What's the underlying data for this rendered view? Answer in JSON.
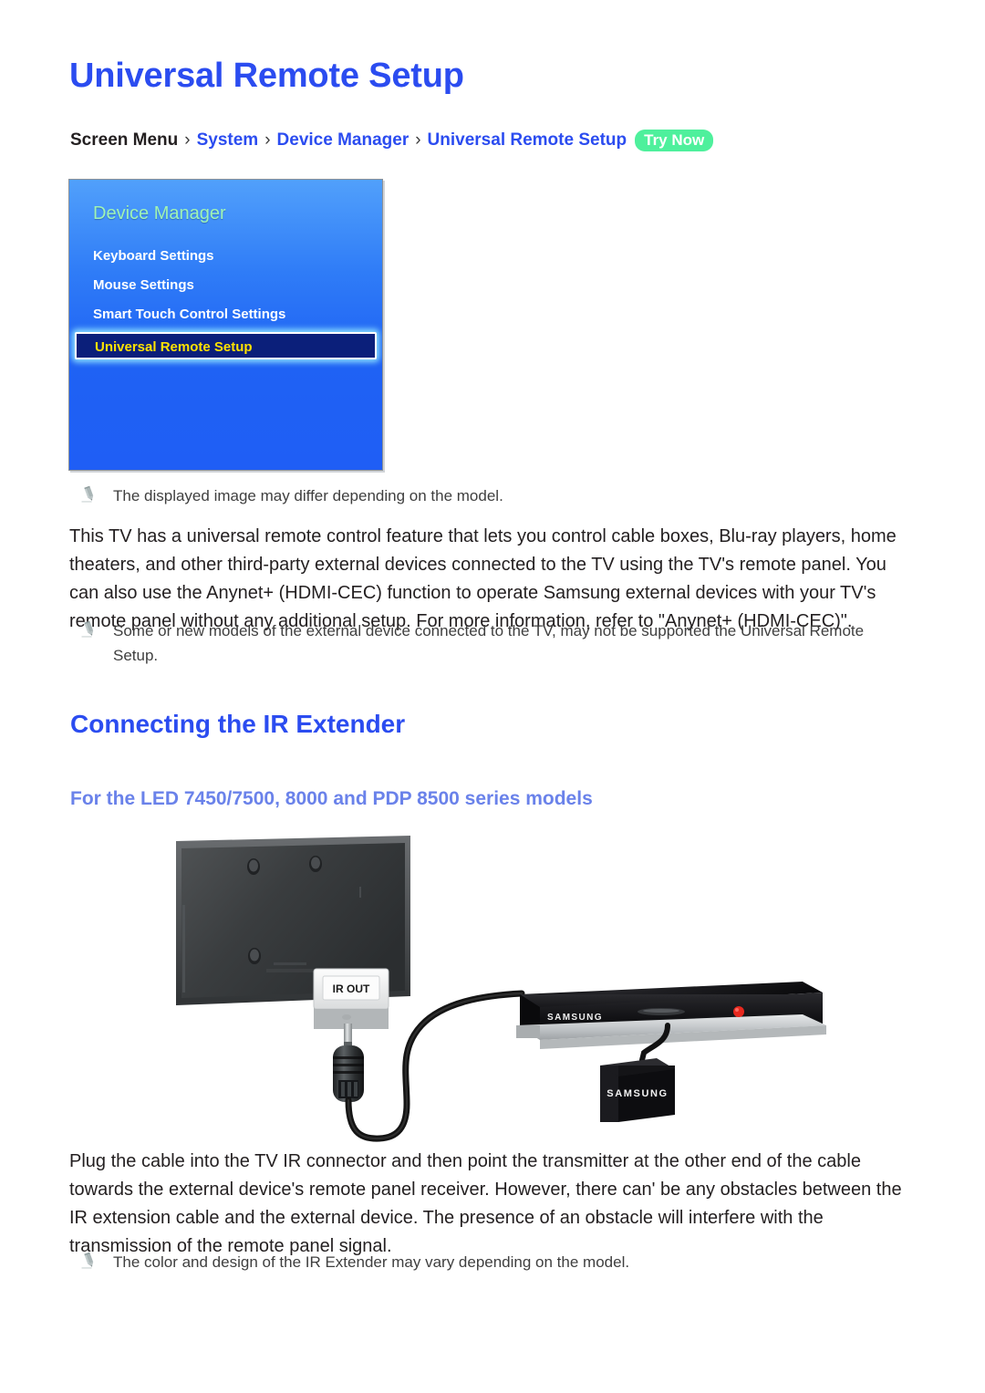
{
  "document": {
    "title": "Universal Remote Setup"
  },
  "breadcrumb": {
    "root": "Screen Menu",
    "separator": "›",
    "items": [
      "System",
      "Device Manager",
      "Universal Remote Setup"
    ],
    "badge": "Try Now",
    "badge_color": "#4ef09c"
  },
  "menu_screenshot": {
    "title": "Device Manager",
    "title_color": "#9ff3b6",
    "items": [
      {
        "label": "Keyboard Settings",
        "selected": false
      },
      {
        "label": "Mouse Settings",
        "selected": false
      },
      {
        "label": "Smart Touch Control Settings",
        "selected": false
      },
      {
        "label": "Universal Remote Setup",
        "selected": true
      }
    ],
    "selected_text_color": "#ffe200",
    "selected_bg_color": "#0b1f7a"
  },
  "notes": {
    "image_note": "The displayed image may differ depending on the model.",
    "support_note": "Some or new models of the external device connected to the TV, may not be supported the Universal Remote Setup.",
    "extender_note": "The color and design of the IR Extender may vary depending on the model."
  },
  "paragraphs": {
    "intro": "This TV has a universal remote control feature that lets you control cable boxes, Blu-ray players, home theaters, and other third-party external devices connected to the TV using the TV's remote panel. You can also use the Anynet+ (HDMI-CEC) function to operate Samsung external devices with your TV's remote panel without any additional setup. For more information, refer to \"Anynet+ (HDMI-CEC)\".",
    "plug": "Plug the cable into the TV IR connector and then point the transmitter at the other end of the cable towards the external device's remote panel receiver. However, there can' be any obstacles between the IR extension cable and the external device. The presence of an obstacle will interfere with the transmission of the remote panel signal."
  },
  "headings": {
    "connecting": "Connecting the IR Extender",
    "models": "For the LED 7450/7500, 8000 and PDP 8500 series models"
  },
  "diagram": {
    "port_label": "IR OUT",
    "player_brand": "SAMSUNG",
    "transmitter_brand": "SAMSUNG",
    "led_color": "#e8281e"
  }
}
